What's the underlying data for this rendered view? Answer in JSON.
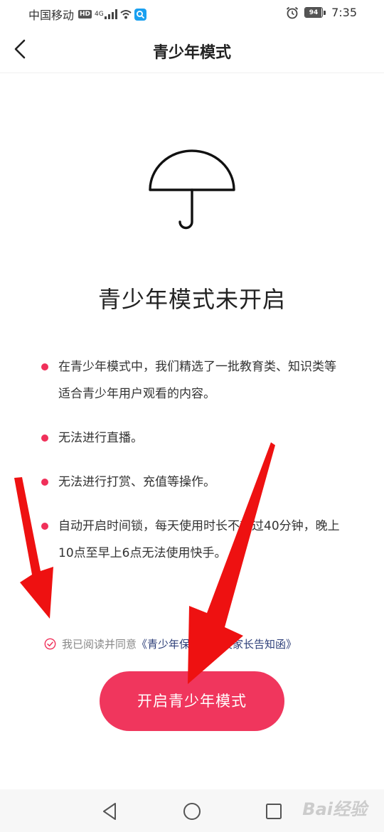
{
  "status_bar": {
    "carrier": "中国移动",
    "hd": "HD",
    "network_type": "4G",
    "battery": "94",
    "battery_level": 0.94,
    "time": "7:35",
    "icons": [
      "signal-icon",
      "wifi-icon",
      "search-app-icon",
      "alarm-icon",
      "battery-icon"
    ]
  },
  "header": {
    "back_icon": "chevron-left-icon",
    "title": "青少年模式"
  },
  "main": {
    "illustration_icon": "umbrella-icon",
    "status_text": "青少年模式未开启",
    "bullets": [
      "在青少年模式中，我们精选了一批教育类、知识类等适合青少年用户观看的内容。",
      "无法进行直播。",
      "无法进行打赏、充值等操作。",
      "自动开启时间锁，每天使用时长不超过40分钟，晚上10点至早上6点无法使用快手。"
    ],
    "accent_color": "#f0305a"
  },
  "agreement": {
    "prefix": "我已阅读并同意",
    "link": "《青少年保护协议及家长告知函》",
    "checked": true,
    "check_icon": "check-circle-icon"
  },
  "primary_button": {
    "label": "开启青少年模式",
    "color": "#f0365d"
  },
  "nav_bar": {
    "icons": [
      "nav-back-icon",
      "nav-home-icon",
      "nav-recent-icon"
    ]
  },
  "watermark": {
    "text": "Bai经验"
  },
  "annotation_color": "#ee1111"
}
